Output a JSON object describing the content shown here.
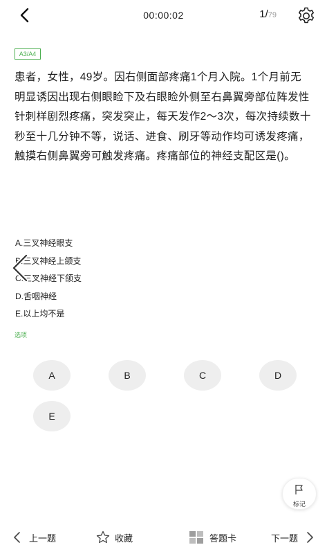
{
  "header": {
    "timer": "00:00:02",
    "progress_current": "1",
    "progress_total": "79"
  },
  "question": {
    "type_badge": "A3/A4",
    "text": "患者，女性，49岁。因右侧面部疼痛1个月入院。1个月前无明显诱因出现右侧眼睑下及右眼睑外侧至右鼻翼旁部位阵发性针刺样剧烈疼痛，突发突止，每天发作2～3次，每次持续数十秒至十几分钟不等，说话、进食、刷牙等动作均可诱发疼痛，触摸右侧鼻翼旁可触发疼痛。疼痛部位的神经支配区是()。",
    "options": [
      "A.三叉神经眼支",
      "B.三叉神经上颌支",
      "C.三叉神经下颌支",
      "D.舌咽神经",
      "E.以上均不是"
    ]
  },
  "answer_section": {
    "label": "选项",
    "buttons": [
      "A",
      "B",
      "C",
      "D",
      "E"
    ]
  },
  "mark": {
    "label": "标记"
  },
  "bottom_bar": {
    "prev": "上一题",
    "favorite": "收藏",
    "answer_card": "答题卡",
    "next": "下一题"
  },
  "colors": {
    "accent_green": "#4caf50",
    "answer_button_bg": "#eeeeee"
  }
}
